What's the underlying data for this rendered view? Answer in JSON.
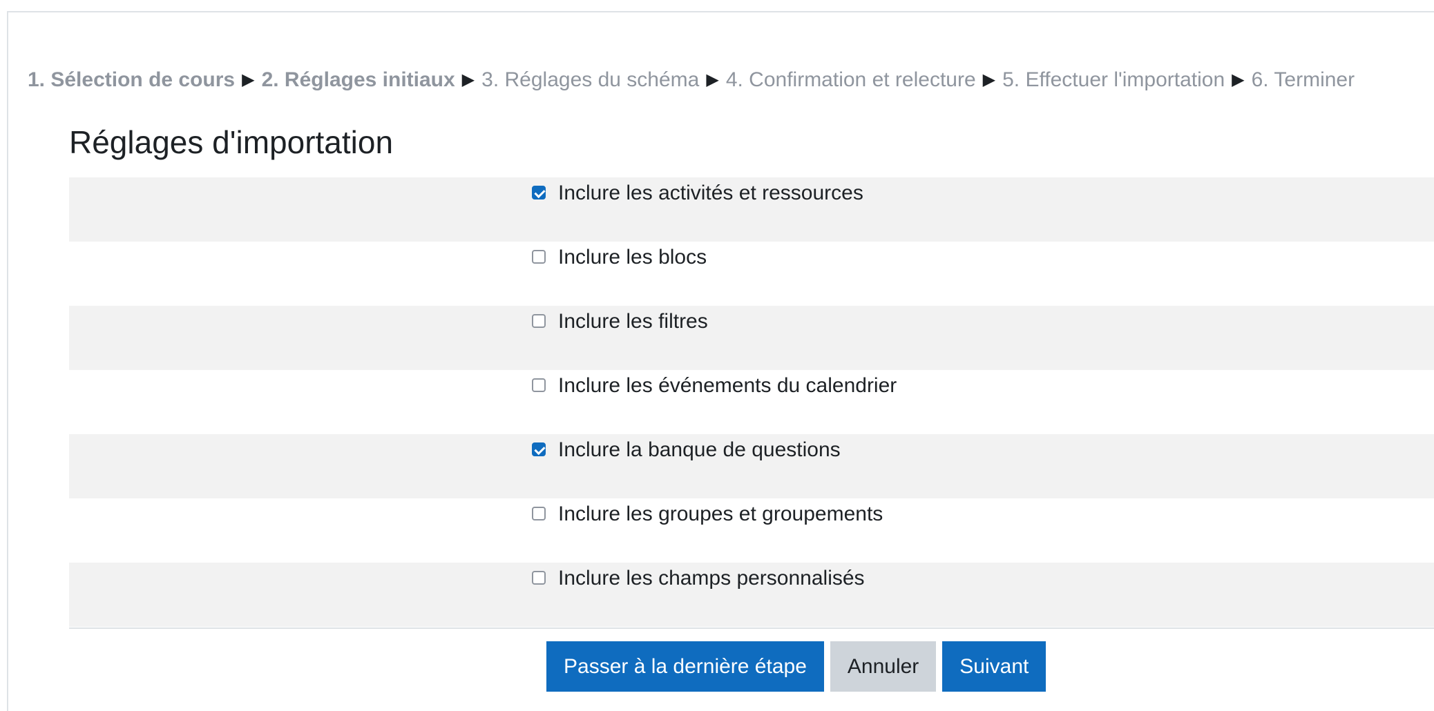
{
  "progress": {
    "steps": [
      {
        "label": "1. Sélection de cours",
        "state": "done"
      },
      {
        "label": "2. Réglages initiaux",
        "state": "current"
      },
      {
        "label": "3. Réglages du schéma",
        "state": "pending"
      },
      {
        "label": "4. Confirmation et relecture",
        "state": "pending"
      },
      {
        "label": "5. Effectuer l'importation",
        "state": "pending"
      },
      {
        "label": "6. Terminer",
        "state": "pending"
      }
    ],
    "separator": "▶"
  },
  "heading": "Réglages d'importation",
  "options": [
    {
      "label": "Inclure les activités et ressources",
      "checked": true
    },
    {
      "label": "Inclure les blocs",
      "checked": false
    },
    {
      "label": "Inclure les filtres",
      "checked": false
    },
    {
      "label": "Inclure les événements du calendrier",
      "checked": false
    },
    {
      "label": "Inclure la banque de questions",
      "checked": true
    },
    {
      "label": "Inclure les groupes et groupements",
      "checked": false
    },
    {
      "label": "Inclure les champs personnalisés",
      "checked": false
    }
  ],
  "buttons": {
    "skip_label": "Passer à la dernière étape",
    "cancel_label": "Annuler",
    "next_label": "Suivant"
  },
  "colors": {
    "primary": "#0f6cbf",
    "secondary": "#ced4da",
    "muted_text": "#8f959e",
    "row_shade": "#f2f2f2"
  }
}
